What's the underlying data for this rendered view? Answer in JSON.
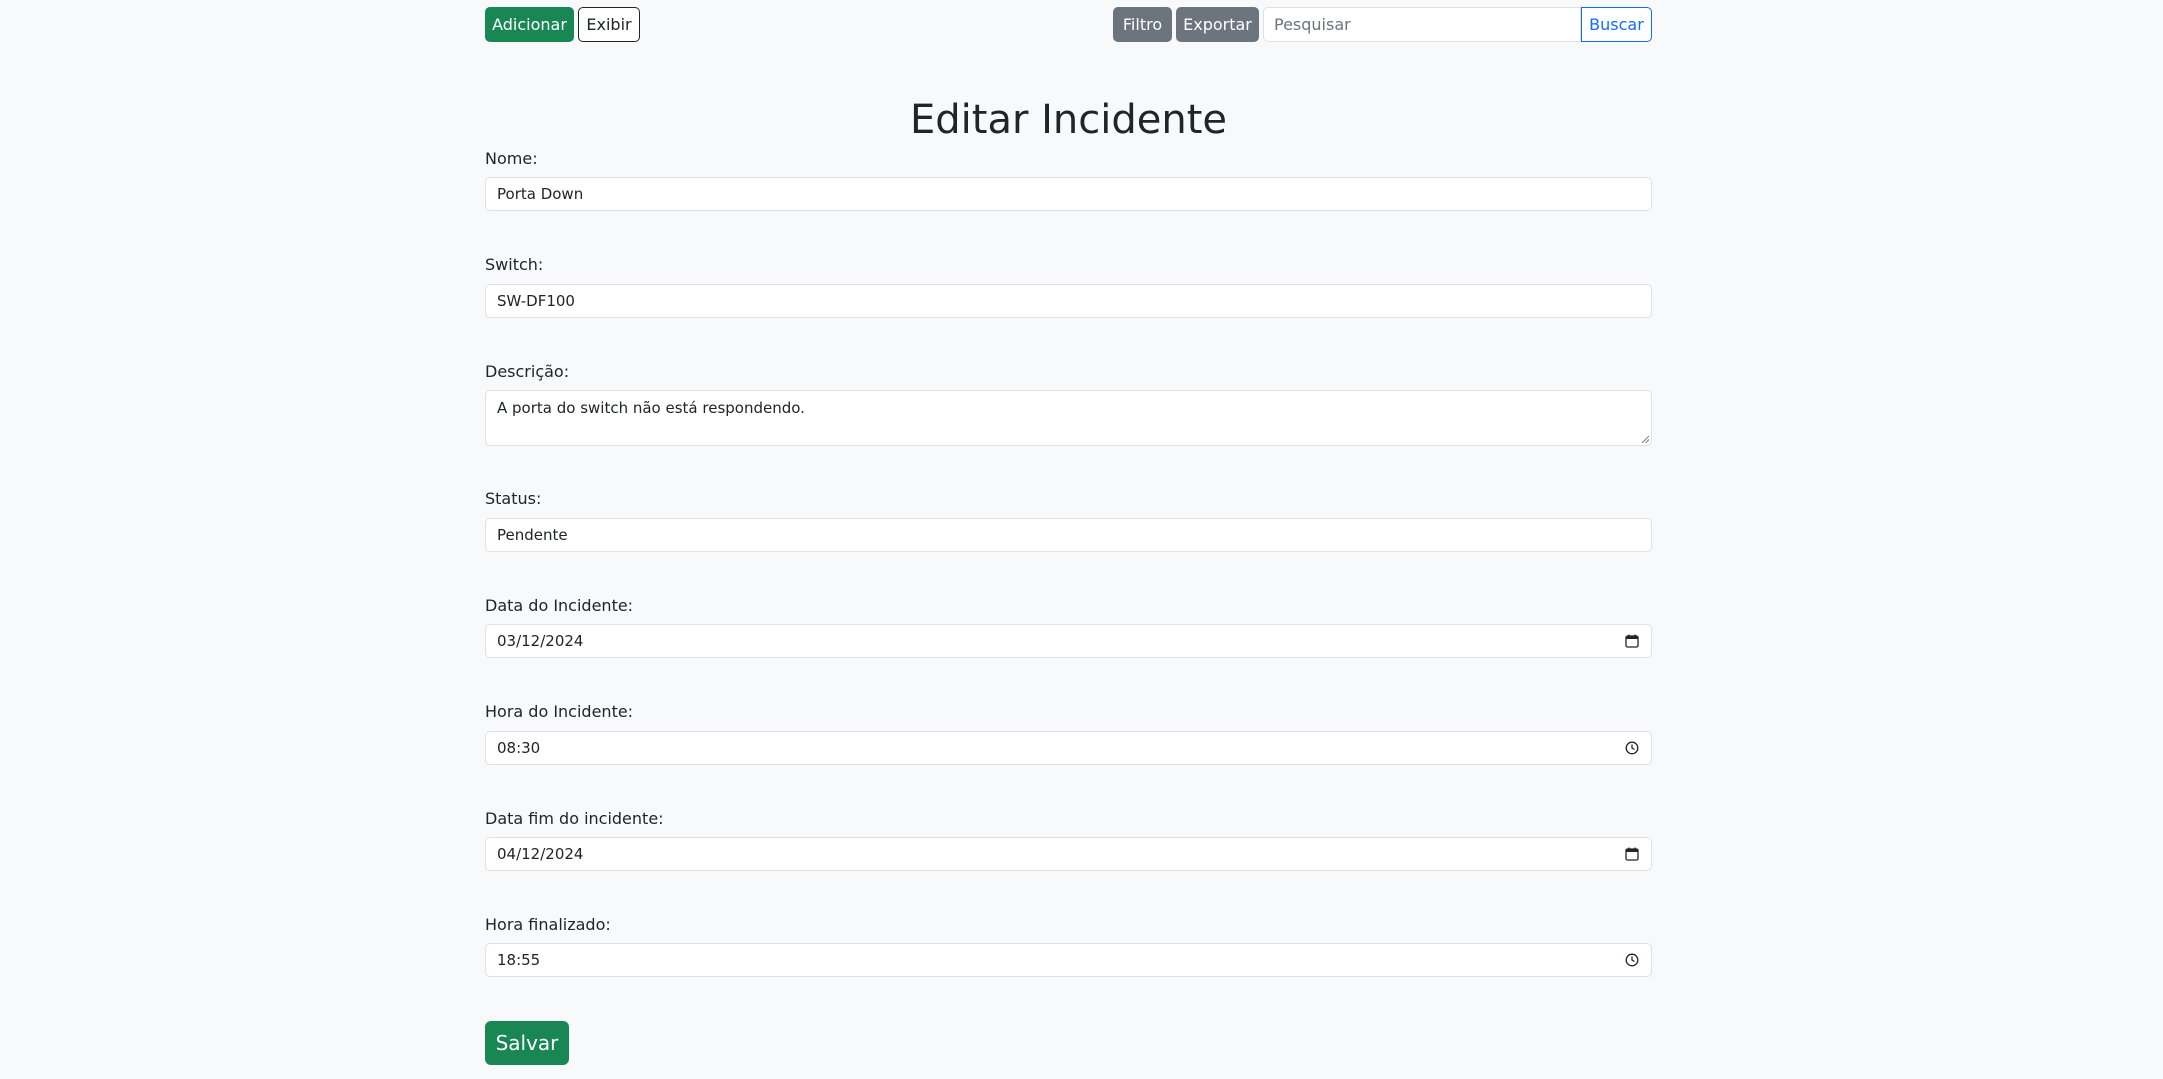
{
  "toolbar": {
    "add_label": "Adicionar",
    "show_label": "Exibir",
    "filter_label": "Filtro",
    "export_label": "Exportar",
    "search_placeholder": "Pesquisar",
    "search_label": "Buscar"
  },
  "page": {
    "title": "Editar Incidente"
  },
  "form": {
    "nome": {
      "label": "Nome:",
      "value": "Porta Down"
    },
    "switch": {
      "label": "Switch:",
      "value": "SW-DF100"
    },
    "descricao": {
      "label": "Descrição:",
      "value": "A porta do switch não está respondendo."
    },
    "status": {
      "label": "Status:",
      "value": "Pendente"
    },
    "data_incidente": {
      "label": "Data do Incidente:",
      "value": "03/12/2024"
    },
    "hora_incidente": {
      "label": "Hora do Incidente:",
      "value": "08:30"
    },
    "data_fim": {
      "label": "Data fim do incidente:",
      "value": "04/12/2024"
    },
    "hora_finalizado": {
      "label": "Hora finalizado:",
      "value": "18:55"
    },
    "save_label": "Salvar"
  },
  "icons": {
    "calendar": "calendar-icon",
    "clock": "clock-icon",
    "resize": "resize-handle-icon"
  },
  "colors": {
    "primary_green": "#198754",
    "secondary_gray": "#6c757d",
    "link_blue": "#0d6efd",
    "background": "#f8f9fa"
  }
}
